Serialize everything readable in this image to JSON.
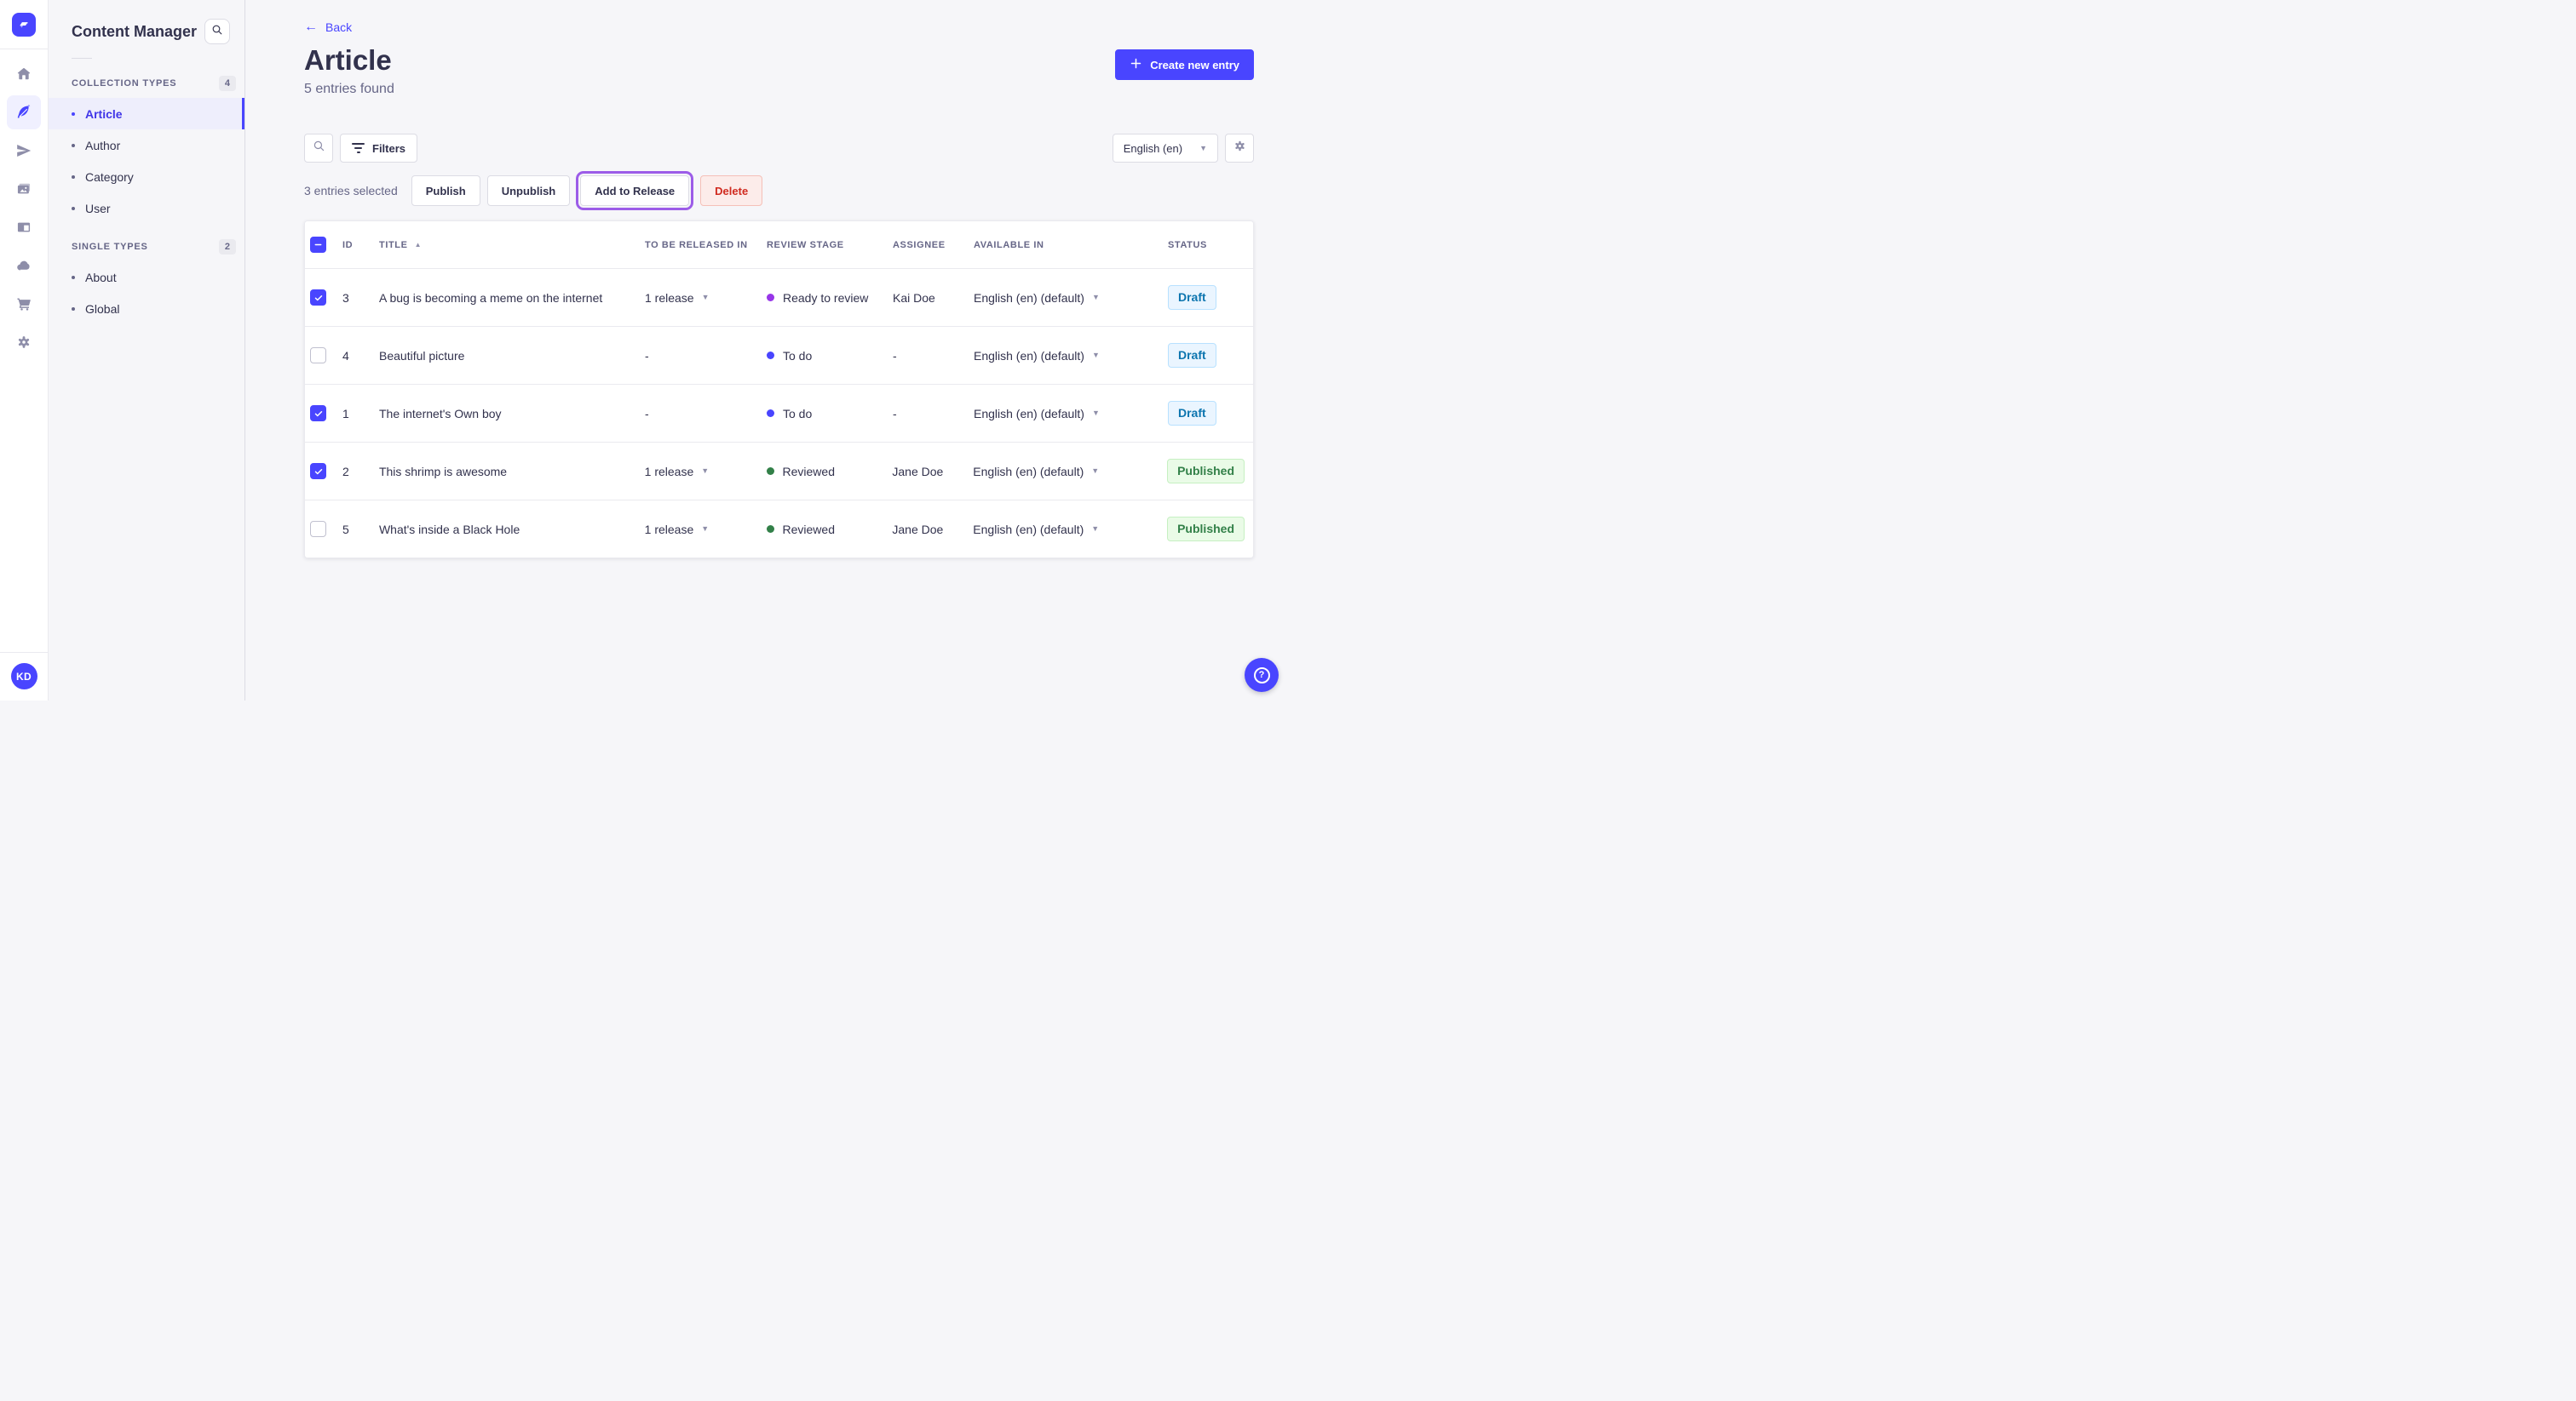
{
  "nav": {
    "icons": [
      "strapi-logo",
      "home",
      "content-manager",
      "releases",
      "media-library",
      "content-type-builder",
      "deploy",
      "marketplace",
      "settings"
    ],
    "active_icon": "content-manager",
    "avatar_initials": "KD"
  },
  "subnav": {
    "title": "Content Manager",
    "search_icon": "search-icon",
    "sections": [
      {
        "label": "COLLECTION TYPES",
        "count": "4",
        "items": [
          {
            "label": "Article"
          },
          {
            "label": "Author"
          },
          {
            "label": "Category"
          },
          {
            "label": "User"
          }
        ]
      },
      {
        "label": "SINGLE TYPES",
        "count": "2",
        "items": [
          {
            "label": "About"
          },
          {
            "label": "Global"
          }
        ]
      }
    ],
    "active_item": "Article"
  },
  "header": {
    "back_label": "Back",
    "back_arrow": "←",
    "title": "Article",
    "subtitle": "5 entries found",
    "create_button": "Create new entry"
  },
  "toolbar": {
    "filters_label": "Filters",
    "locale_value": "English (en)"
  },
  "selection": {
    "text": "3 entries selected",
    "publish": "Publish",
    "unpublish": "Unpublish",
    "add_to_release": "Add to Release",
    "delete": "Delete"
  },
  "table": {
    "columns": {
      "id": "ID",
      "title": "TITLE",
      "release": "TO BE RELEASED IN",
      "review": "REVIEW STAGE",
      "assignee": "ASSIGNEE",
      "available": "AVAILABLE IN",
      "status": "STATUS"
    },
    "sort": {
      "column": "TITLE",
      "direction": "asc",
      "arrow": "▲"
    },
    "header_checkbox_state": "indeterminate",
    "rows": [
      {
        "checked": true,
        "id": "3",
        "title": "A bug is becoming a meme on the internet",
        "release": "1 release",
        "release_caret": true,
        "stage": "Ready to review",
        "stage_color": "#9736e8",
        "assignee": "Kai Doe",
        "locale": "English (en) (default)",
        "status": "Draft",
        "status_type": "draft"
      },
      {
        "checked": false,
        "id": "4",
        "title": "Beautiful picture",
        "release": "-",
        "release_caret": false,
        "stage": "To do",
        "stage_color": "#4945ff",
        "assignee": "-",
        "locale": "English (en) (default)",
        "status": "Draft",
        "status_type": "draft"
      },
      {
        "checked": true,
        "id": "1",
        "title": "The internet's Own boy",
        "release": "-",
        "release_caret": false,
        "stage": "To do",
        "stage_color": "#4945ff",
        "assignee": "-",
        "locale": "English (en) (default)",
        "status": "Draft",
        "status_type": "draft"
      },
      {
        "checked": true,
        "id": "2",
        "title": "This shrimp is awesome",
        "release": "1 release",
        "release_caret": true,
        "stage": "Reviewed",
        "stage_color": "#328048",
        "assignee": "Jane Doe",
        "locale": "English (en) (default)",
        "status": "Published",
        "status_type": "published"
      },
      {
        "checked": false,
        "id": "5",
        "title": "What's inside a Black Hole",
        "release": "1 release",
        "release_caret": true,
        "stage": "Reviewed",
        "stage_color": "#328048",
        "assignee": "Jane Doe",
        "locale": "English (en) (default)",
        "status": "Published",
        "status_type": "published"
      }
    ]
  },
  "help": {
    "icon": "question-mark-icon"
  },
  "colors": {
    "primary": "#4945ff",
    "primary_light_bg": "#f0f0ff",
    "page_bg": "#f6f6f9",
    "border": "#eaeaef",
    "text_dark": "#32324d",
    "text_muted": "#666687",
    "icon_gray": "#8e8ea9",
    "release_outline": "#9c5ce8",
    "draft_text": "#0c75af",
    "draft_bg": "#eaf5ff",
    "published_text": "#328048",
    "published_bg": "#eafbe7",
    "delete_text": "#d02b20",
    "delete_bg": "#fcecea"
  }
}
